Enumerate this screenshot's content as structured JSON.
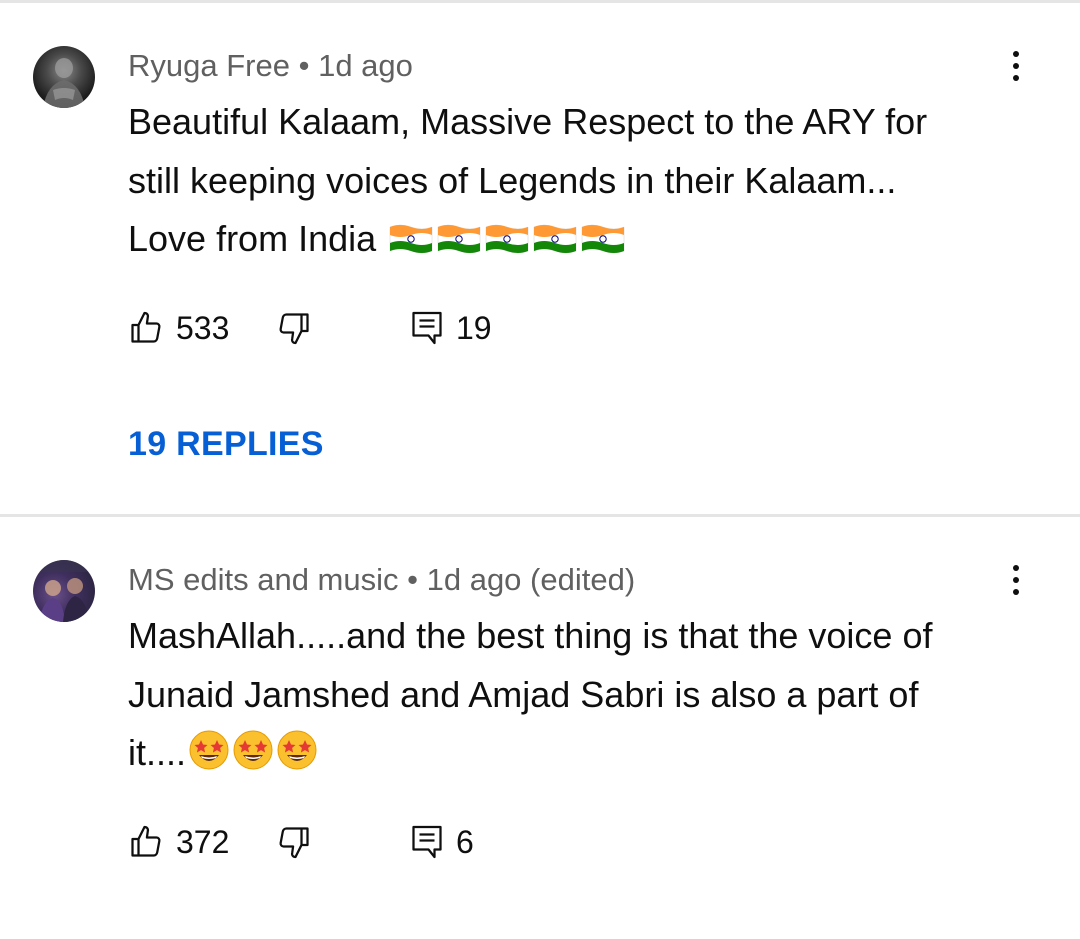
{
  "comments": [
    {
      "author": "Ryuga Free",
      "separator": "•",
      "time": "1d ago",
      "text_lines": [
        "Beautiful Kalaam, Massive Respect to the ARY for",
        "still keeping voices of Legends in their Kalaam...",
        "Love from India "
      ],
      "emoji": "indian-flag x5",
      "likes": "533",
      "reply_count": "19",
      "replies_label": "19 REPLIES"
    },
    {
      "author": "MS edits and music",
      "separator": "•",
      "time": "1d ago (edited)",
      "text_lines": [
        "MashAllah.....and the best thing is that the voice of",
        "Junaid Jamshed and Amjad Sabri is also a part of",
        "it...."
      ],
      "emoji": "star-struck-face x3",
      "likes": "372",
      "reply_count": "6"
    }
  ],
  "colors": {
    "link_blue": "#065fd4",
    "meta_gray": "#606060",
    "divider": "#e5e5e5"
  }
}
